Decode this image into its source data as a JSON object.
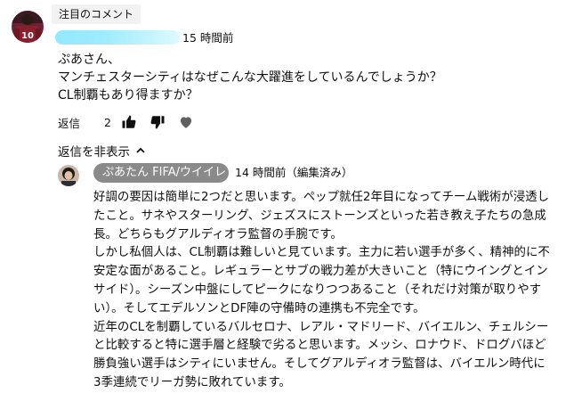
{
  "pinned_label": "注目のコメント",
  "comment": {
    "time": "15 時間前",
    "lines": [
      "ぷあさん、",
      "マンチェスターシティはなぜこんな大躍進をしているんでしょうか？",
      "CL制覇もあり得ますか？"
    ],
    "reply_label": "返信",
    "like_count": "2",
    "avatar_number": "10"
  },
  "hide_replies_label": "返信を非表示",
  "reply": {
    "author": "ぷあたん FIFA/ウイイレ",
    "time": "14 時間前（編集済み）",
    "lines": [
      "好調の要因は簡単に2つだと思います。ペップ就任2年目になってチーム戦術が浸透し",
      "たこと。サネやスターリング、ジェズスにストーンズといった若き教え子たちの急成",
      "長。どちらもグアルディオラ監督の手腕です。",
      "しかし私個人は、CL制覇は難しいと見ています。主力に若い選手が多く、精神的に不",
      "安定な面があること。レギュラーとサブの戦力差が大きいこと（特にウイングとイン",
      "サイド）。シーズン中盤にしてピークになりつつあること（それだけ対策が取りやす",
      "い）。そしてエデルソンとDF陣の守備時の連携も不完全です。",
      "近年のCLを制覇しているバルセロナ、レアル・マドリード、バイエルン、チェルシー",
      "と比較すると特に選手層と経験で劣ると思います。メッシ、ロナウド、ドログバほど",
      "勝負強い選手はシティにいません。そしてグアルディオラ監督は、バイエルン時代に",
      "3季連続でリーガ勢に敗れています。"
    ]
  },
  "icons": {
    "like": "thumbs-up-filled-icon",
    "dislike": "thumbs-down-filled-icon",
    "heart": "heart-icon",
    "chevron": "chevron-up-icon"
  },
  "colors": {
    "author_pill": "#8a8a8a",
    "pinned_pill": "#f2f2f2",
    "redaction": "#7fe5ff"
  }
}
